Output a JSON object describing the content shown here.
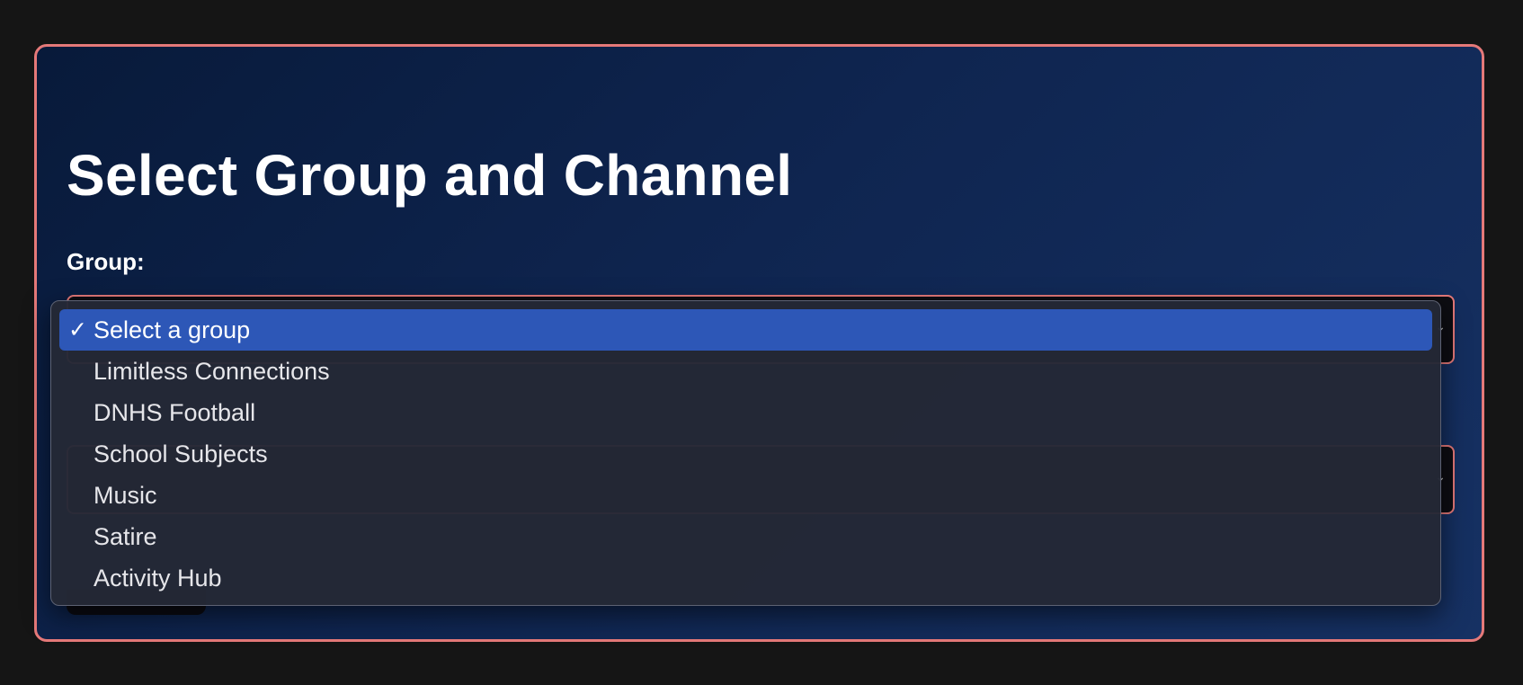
{
  "form": {
    "title": "Select Group and Channel",
    "group_label": "Group:"
  },
  "group_dropdown": {
    "selected": "Select a group",
    "options": [
      "Select a group",
      "Limitless Connections",
      "DNHS Football",
      "School Subjects",
      "Music",
      "Satire",
      "Activity Hub"
    ]
  },
  "colors": {
    "accent_border": "#e57979",
    "selected_option": "#2d57b7",
    "panel_gradient_start": "#081a3a",
    "panel_gradient_end": "#163163"
  },
  "icons": {
    "selected_marker": "check-icon",
    "select_indicator": "chevron-icon"
  }
}
